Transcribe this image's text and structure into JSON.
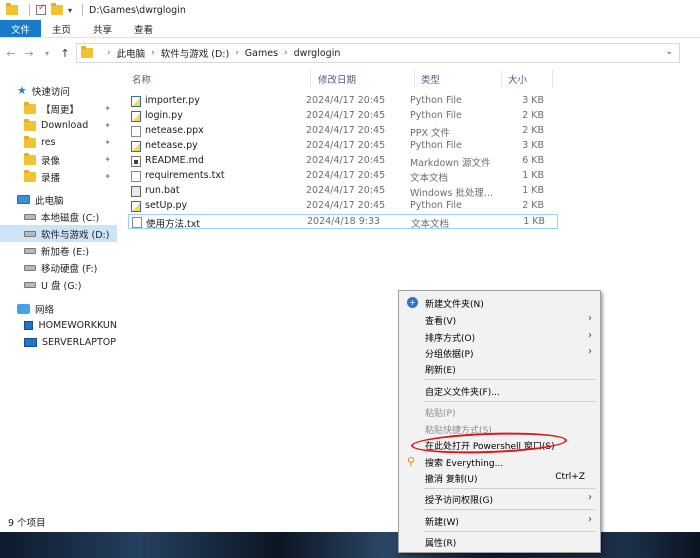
{
  "window": {
    "title": "D:\\Games\\dwrglogin"
  },
  "ribbon": {
    "tabs": [
      "文件",
      "主页",
      "共享",
      "查看"
    ]
  },
  "address": {
    "crumbs": [
      "此电脑",
      "软件与游戏 (D:)",
      "Games",
      "dwrglogin"
    ]
  },
  "nav": {
    "quick_access": "快速访问",
    "quick_items": [
      "【周更】",
      "Download",
      "res",
      "录像",
      "录播"
    ],
    "this_pc": "此电脑",
    "drives": [
      "本地磁盘 (C:)",
      "软件与游戏 (D:)",
      "新加卷 (E:)",
      "移动硬盘 (F:)",
      "U 盘 (G:)"
    ],
    "network": "网络",
    "network_items": [
      "HOMEWORKKUN",
      "SERVERLAPTOP"
    ]
  },
  "columns": {
    "name": "名称",
    "date": "修改日期",
    "type": "类型",
    "size": "大小"
  },
  "files": [
    {
      "name": "importer.py",
      "date": "2024/4/17 20:45",
      "type": "Python File",
      "size": "3 KB"
    },
    {
      "name": "login.py",
      "date": "2024/4/17 20:45",
      "type": "Python File",
      "size": "2 KB"
    },
    {
      "name": "netease.ppx",
      "date": "2024/4/17 20:45",
      "type": "PPX 文件",
      "size": "2 KB"
    },
    {
      "name": "netease.py",
      "date": "2024/4/17 20:45",
      "type": "Python File",
      "size": "3 KB"
    },
    {
      "name": "README.md",
      "date": "2024/4/17 20:45",
      "type": "Markdown 源文件",
      "size": "6 KB"
    },
    {
      "name": "requirements.txt",
      "date": "2024/4/17 20:45",
      "type": "文本文档",
      "size": "1 KB"
    },
    {
      "name": "run.bat",
      "date": "2024/4/17 20:45",
      "type": "Windows 批处理...",
      "size": "1 KB"
    },
    {
      "name": "setUp.py",
      "date": "2024/4/17 20:45",
      "type": "Python File",
      "size": "2 KB"
    },
    {
      "name": "使用方法.txt",
      "date": "2024/4/18 9:33",
      "type": "文本文档",
      "size": "1 KB"
    }
  ],
  "status": {
    "count": "9 个项目"
  },
  "context_menu": {
    "new_folder": "新建文件夹(N)",
    "view": "查看(V)",
    "sort": "排序方式(O)",
    "group": "分组依据(P)",
    "refresh": "刷新(E)",
    "customize": "自定义文件夹(F)...",
    "paste": "粘贴(P)",
    "paste_shortcut": "粘贴快捷方式(S)",
    "powershell": "在此处打开 Powershell 窗口(S)",
    "everything": "搜索 Everything...",
    "undo": "撤消 复制(U)",
    "undo_shortcut": "Ctrl+Z",
    "give_access": "授予访问权限(G)",
    "new": "新建(W)",
    "properties": "属性(R)"
  }
}
